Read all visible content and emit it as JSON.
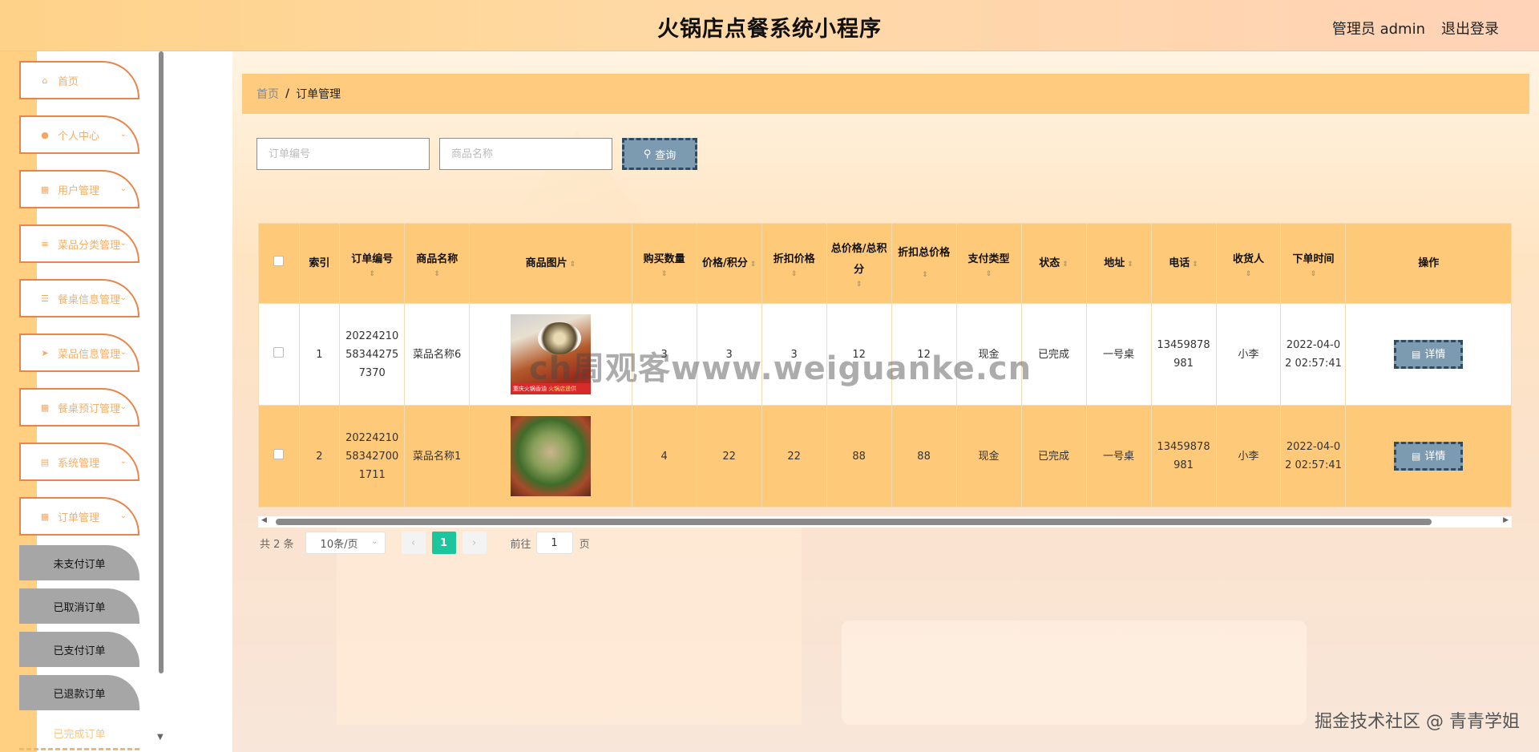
{
  "header": {
    "title": "火锅店点餐系统小程序",
    "admin_label": "管理员 admin",
    "logout_label": "退出登录"
  },
  "sidebar": {
    "items": [
      {
        "label": "首页",
        "icon": "home-icon"
      },
      {
        "label": "个人中心",
        "icon": "user-icon"
      },
      {
        "label": "用户管理",
        "icon": "grid-icon"
      },
      {
        "label": "菜品分类管理",
        "icon": "sliders-icon"
      },
      {
        "label": "餐桌信息管理",
        "icon": "list-icon"
      },
      {
        "label": "菜品信息管理",
        "icon": "send-icon"
      },
      {
        "label": "餐桌预订管理",
        "icon": "grid-icon"
      },
      {
        "label": "系统管理",
        "icon": "clipboard-icon"
      },
      {
        "label": "订单管理",
        "icon": "grid-icon"
      }
    ],
    "submenu": [
      {
        "label": "未支付订单"
      },
      {
        "label": "已取消订单"
      },
      {
        "label": "已支付订单"
      },
      {
        "label": "已退款订单"
      },
      {
        "label": "已完成订单"
      }
    ]
  },
  "breadcrumb": {
    "home": "首页",
    "separator": "/",
    "current": "订单管理"
  },
  "search": {
    "order_no_placeholder": "订单编号",
    "product_name_placeholder": "商品名称",
    "button_label": "查询"
  },
  "table": {
    "columns": [
      "索引",
      "订单编号",
      "商品名称",
      "商品图片",
      "购买数量",
      "价格/积分",
      "折扣价格",
      "总价格/总积分",
      "折扣总价格",
      "支付类型",
      "状态",
      "地址",
      "电话",
      "收货人",
      "下单时间",
      "操作"
    ],
    "rows": [
      {
        "index": "1",
        "order_no": "20224210583442757370",
        "product_name": "菜品名称6",
        "image": "hotpot-dish-image-1",
        "quantity": "3",
        "price": "3",
        "discount_price": "3",
        "total": "12",
        "discount_total": "12",
        "pay_type": "现金",
        "status": "已完成",
        "address": "一号桌",
        "phone": "13459878981",
        "receiver": "小李",
        "order_time": "2022-04-02 02:57:41",
        "action": "详情"
      },
      {
        "index": "2",
        "order_no": "20224210583427001711",
        "product_name": "菜品名称1",
        "image": "hotpot-dish-image-2",
        "quantity": "4",
        "price": "22",
        "discount_price": "22",
        "total": "88",
        "discount_total": "88",
        "pay_type": "现金",
        "status": "已完成",
        "address": "一号桌",
        "phone": "13459878981",
        "receiver": "小李",
        "order_time": "2022-04-02 02:57:41",
        "action": "详情"
      }
    ]
  },
  "image_captions": {
    "row1_left": "重庆火锅香油",
    "row1_right": "火锅店遥供"
  },
  "pagination": {
    "total": "共 2 条",
    "page_size": "10条/页",
    "prev": "‹",
    "current_page": "1",
    "next": "›",
    "goto_label": "前往",
    "goto_value": "1",
    "page_unit": "页"
  },
  "watermark": "ch周观客www.weiguanke.cn",
  "credit": "掘金技术社区 @ 青青学姐",
  "colors": {
    "header_bg": "#ffd289",
    "accent_orange": "#ffc97a",
    "menu_border": "#e8854a",
    "button_blue": "#7d9bb0",
    "page_active": "#1bc69c"
  }
}
